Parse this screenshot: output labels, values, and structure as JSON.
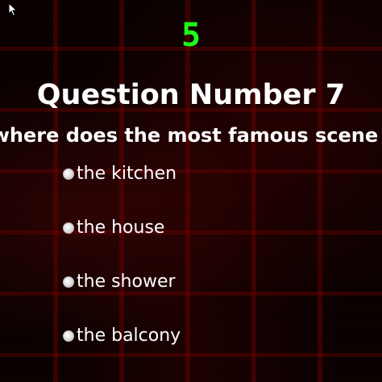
{
  "timer": {
    "value": "5",
    "color": "#1cff1c"
  },
  "question": {
    "title": "Question Number 7",
    "text": "In Psycho, where does the most famous scene take place?"
  },
  "answers": [
    {
      "label": "the kitchen"
    },
    {
      "label": "the house"
    },
    {
      "label": "the shower"
    },
    {
      "label": "the balcony"
    }
  ],
  "icons": {
    "cursor": "mouse-pointer-icon",
    "option": "radio-button-icon"
  },
  "colors": {
    "background": "#0b0101",
    "grid": "#780000",
    "text": "#ffffff"
  }
}
